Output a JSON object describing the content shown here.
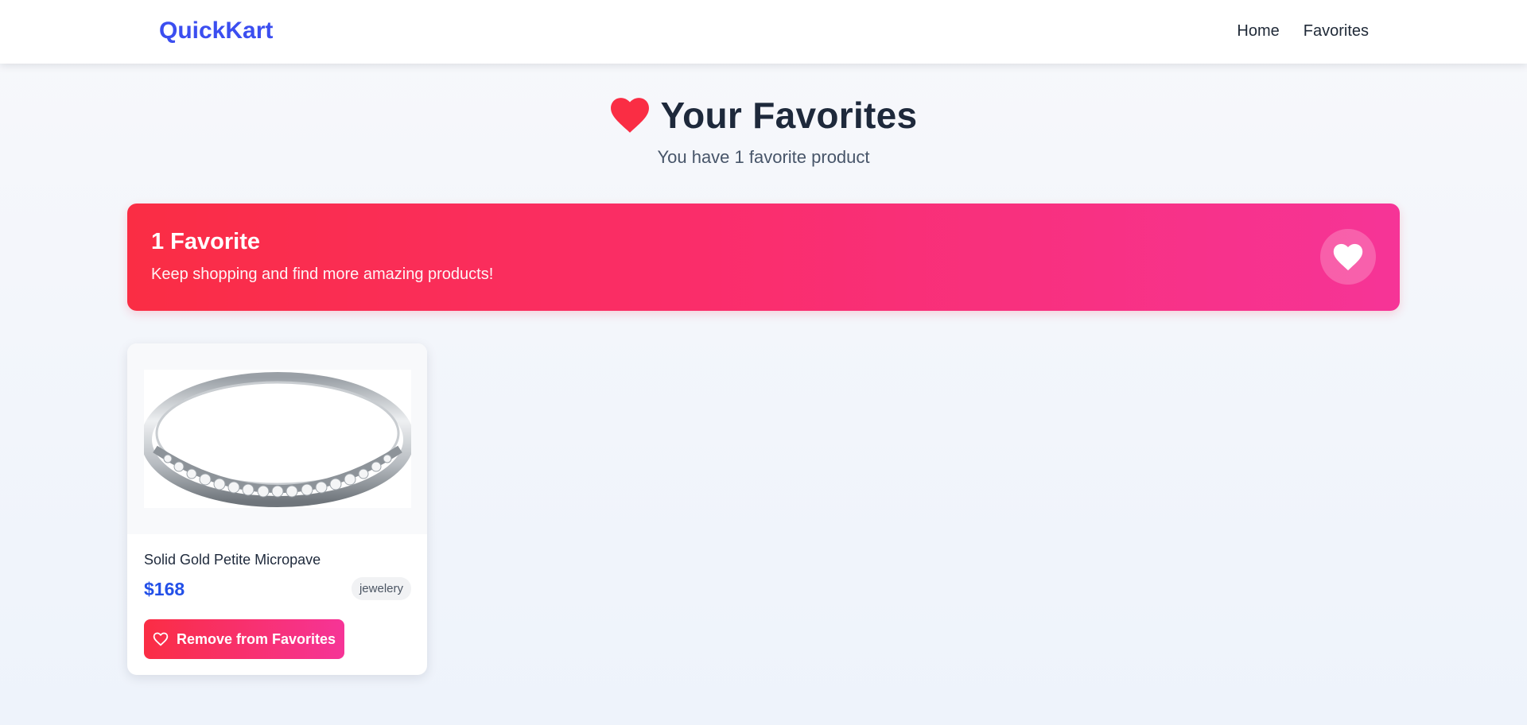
{
  "nav": {
    "brand": "QuickKart",
    "links": [
      {
        "label": "Home"
      },
      {
        "label": "Favorites"
      }
    ]
  },
  "header": {
    "title": "Your Favorites",
    "subtitle": "You have 1 favorite product",
    "icon": "heart-icon",
    "icon_color": "#fa2d44"
  },
  "banner": {
    "title": "1 Favorite",
    "text": "Keep shopping and find more amazing products!",
    "icon": "heart-icon",
    "gradient": [
      "#fa2d44",
      "#f63497"
    ]
  },
  "products": [
    {
      "name": "Solid Gold Petite Micropave",
      "price": "$168",
      "category": "jewelery",
      "image": "ring-image",
      "remove_label": "Remove from Favorites",
      "remove_icon": "heart-outline-icon"
    }
  ],
  "colors": {
    "brand": "#3b4ef0",
    "price": "#2350e8",
    "accent": "#fa2d44"
  }
}
